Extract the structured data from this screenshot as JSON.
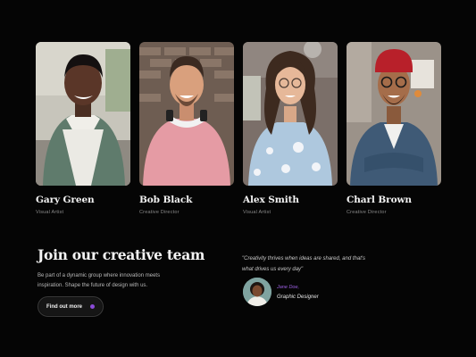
{
  "team": [
    {
      "name": "Gary Green",
      "role": "Visual Artist"
    },
    {
      "name": "Bob Black",
      "role": "Creative Director"
    },
    {
      "name": "Alex Smith",
      "role": "Visual Artist"
    },
    {
      "name": "Charl Brown",
      "role": "Creative Director"
    }
  ],
  "cta": {
    "heading": "Join our creative team",
    "description_line1": "Be part of a dynamic group where innovation meets",
    "description_line2": "inspiration. Shape the future of design with us.",
    "button_label": "Find out more"
  },
  "testimonial": {
    "quote_line1": "\"Creativity thrives when ideas are shared, and that's",
    "quote_line2": "what drives us every day\"",
    "author_name": "Jane Doe,",
    "author_role": "Graphic Designer"
  },
  "colors": {
    "background": "#050505",
    "accent": "#8b4bd8"
  }
}
